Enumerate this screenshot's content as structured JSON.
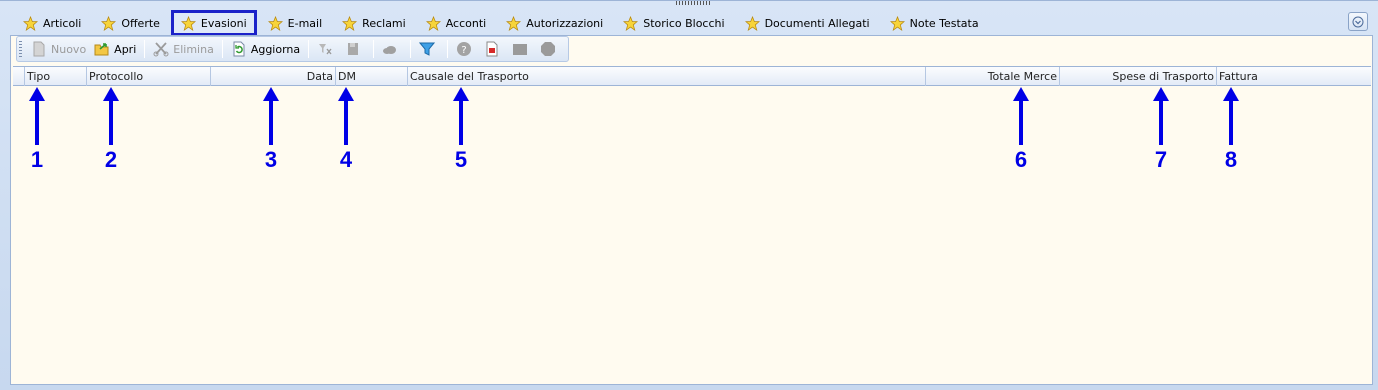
{
  "tabs": [
    {
      "label": "Articoli"
    },
    {
      "label": "Offerte"
    },
    {
      "label": "Evasioni"
    },
    {
      "label": "E-mail"
    },
    {
      "label": "Reclami"
    },
    {
      "label": "Acconti"
    },
    {
      "label": "Autorizzazioni"
    },
    {
      "label": "Storico Blocchi"
    },
    {
      "label": "Documenti Allegati"
    },
    {
      "label": "Note Testata"
    }
  ],
  "active_tab": "Evasioni",
  "toolbar": {
    "nuovo": "Nuovo",
    "apri": "Apri",
    "elimina": "Elimina",
    "aggiorna": "Aggiorna"
  },
  "grid": {
    "columns": [
      {
        "label": "Tipo"
      },
      {
        "label": "Protocollo"
      },
      {
        "label": "Data"
      },
      {
        "label": "DM"
      },
      {
        "label": "Causale del Trasporto"
      },
      {
        "label": "Totale Merce"
      },
      {
        "label": "Spese di Trasporto"
      },
      {
        "label": "Fattura"
      }
    ]
  },
  "annotations": [
    "1",
    "2",
    "3",
    "4",
    "5",
    "6",
    "7",
    "8"
  ],
  "colors": {
    "annotation": "#0000e6",
    "active_tab_border": "#1b22c9",
    "grid_background": "#fffbf0"
  }
}
